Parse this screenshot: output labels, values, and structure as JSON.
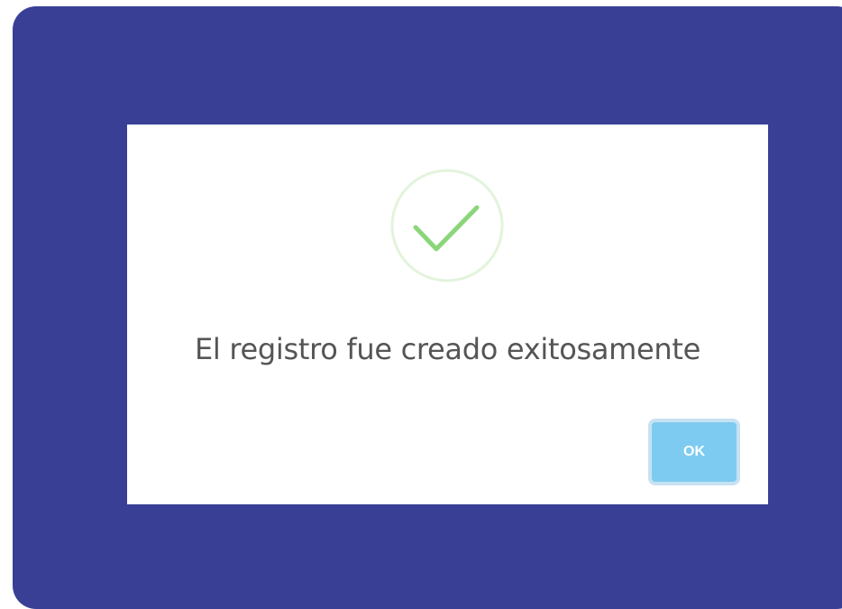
{
  "colors": {
    "backdrop": "#3a3f96",
    "dialog_bg": "#ffffff",
    "success_green": "#8bd67a",
    "success_ring": "#e2f4dc",
    "message_text": "#555555",
    "ok_button_bg": "#7ecbf1",
    "ok_button_border": "#c6e2f3"
  },
  "dialog": {
    "icon": "checkmark-success-icon",
    "message": "El registro fue creado exitosamente",
    "ok_label": "OK"
  }
}
